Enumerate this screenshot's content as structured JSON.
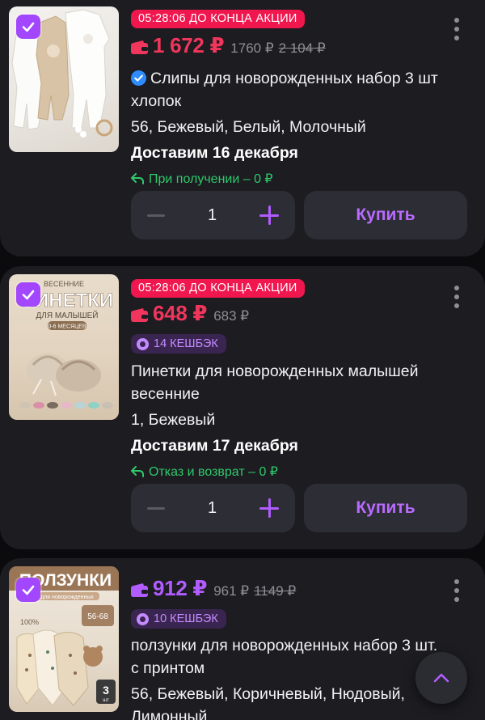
{
  "products": [
    {
      "timer": "05:28:06 ДО КОНЦА АКЦИИ",
      "price": "1 672 ₽",
      "price_old": "1760 ₽",
      "price_original": "2 104 ₽",
      "title_line1": "Слипы для новорожденных набор 3 шт",
      "title_line2": "хлопок",
      "variant": "56, Бежевый, Белый, Молочный",
      "delivery": "Доставим 16 декабря",
      "note": "При получении – 0 ₽",
      "quantity": "1",
      "buy_label": "Купить"
    },
    {
      "timer": "05:28:06 ДО КОНЦА АКЦИИ",
      "price": "648 ₽",
      "price_old": "683 ₽",
      "cashback": "14 КЕШБЭК",
      "image_text_top": "ВЕСЕННИЕ",
      "image_text_main": "ПИНЕТКИ",
      "image_text_sub": "ДЛЯ МАЛЫШЕЙ",
      "image_text_badge": "0-6 МЕСЯЦЕВ",
      "title_line1": "Пинетки для новорожденных малышей",
      "title_line2": "весенние",
      "variant": "1, Бежевый",
      "delivery": "Доставим 17 декабря",
      "note": "Отказ и возврат – 0 ₽",
      "quantity": "1",
      "buy_label": "Купить"
    },
    {
      "price": "912 ₽",
      "price_old": "961 ₽",
      "price_original": "1149 ₽",
      "cashback": "10 КЕШБЭК",
      "image_text_main": "ПОЛЗУНКИ",
      "image_text_sub": "для новорожденных",
      "image_text_size": "56-68",
      "image_text_pct": "100%",
      "image_text_qty": "3",
      "image_text_qty_unit": "шт",
      "title_line1": "ползунки для новорожденных набор 3 шт.",
      "title_line2": "с принтом",
      "variant_line1": "56, Бежевый, Коричневый, Нюдовый,",
      "variant_line2": "Лимонный"
    }
  ],
  "colors": {
    "accent": "#a347ff",
    "price_red": "#f0365c",
    "timer_bg": "#f0164e",
    "note_green": "#2fc96b",
    "card_bg": "#1c1c21"
  }
}
